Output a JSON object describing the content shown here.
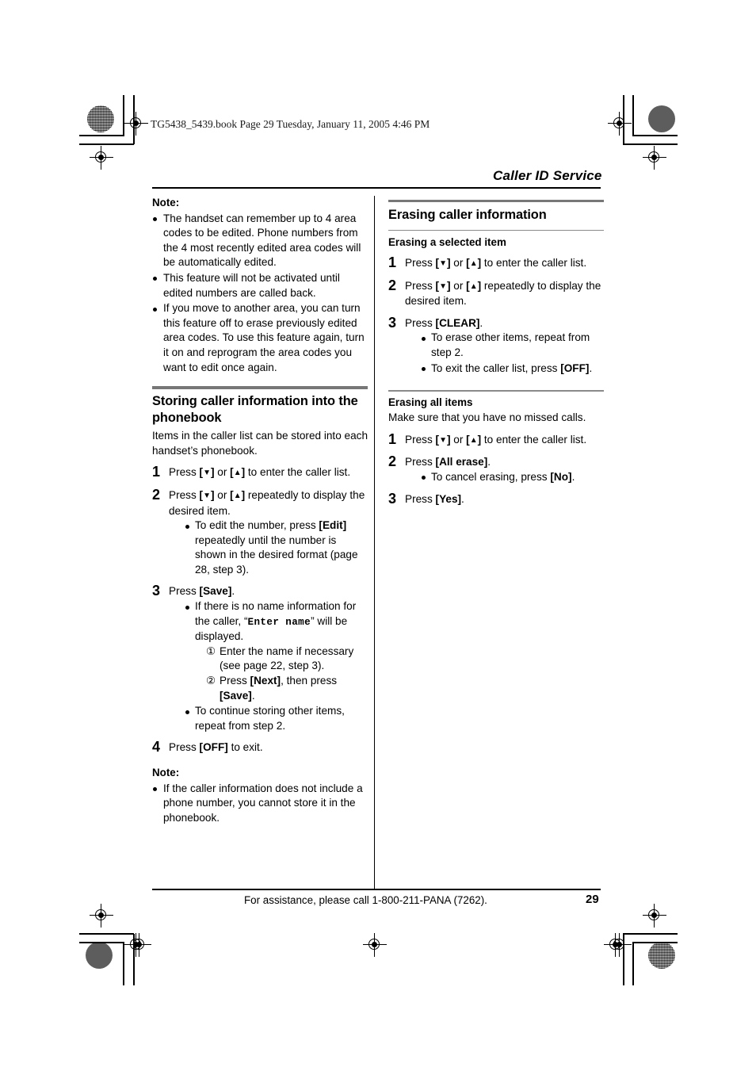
{
  "scan_header": "TG5438_5439.book  Page 29  Tuesday, January 11, 2005  4:46 PM",
  "running_head": "Caller ID Service",
  "left_column": {
    "note_top": {
      "label": "Note:",
      "bullets": [
        "The handset can remember up to 4 area codes to be edited. Phone numbers from the 4 most recently edited area codes will be automatically edited.",
        "This feature will not be activated until edited numbers are called back.",
        "If you move to another area, you can turn this feature off to erase previously edited area codes. To use this feature again, turn it on and reprogram the area codes you want to edit once again."
      ]
    },
    "section": {
      "heading": "Storing caller information into the phonebook",
      "intro": "Items in the caller list can be stored into each handset’s phonebook.",
      "step1": {
        "num": "1",
        "press": "Press",
        "key_down": "▼",
        "or": "or",
        "key_up": "▲",
        "tail": "to enter the caller list."
      },
      "step2": {
        "num": "2",
        "press": "Press",
        "key_down": "▼",
        "or": "or",
        "key_up": "▲",
        "tail": "repeatedly to display the desired item.",
        "bullet_lead": "To edit the number, press",
        "bullet_key": "Edit",
        "bullet_tail": "repeatedly until the number is shown in the desired format (page 28, step 3)."
      },
      "step3": {
        "num": "3",
        "press": "Press",
        "key": "Save",
        "period": ".",
        "bullet1_lead": "If there is no name information for the caller, “",
        "bullet1_lcd": "Enter name",
        "bullet1_tail": "” will be displayed.",
        "sub1_marker": "①",
        "sub1_text": "Enter the name if necessary (see page 22, step 3).",
        "sub2_marker": "②",
        "sub2_lead": "Press",
        "sub2_key1": "Next",
        "sub2_mid": ", then press",
        "sub2_key2": "Save",
        "sub2_end": ".",
        "bullet2": "To continue storing other items, repeat from step 2."
      },
      "step4": {
        "num": "4",
        "press": "Press",
        "key": "OFF",
        "tail": "to exit."
      }
    },
    "note_bottom": {
      "label": "Note:",
      "bullets": [
        "If the caller information does not include a phone number, you cannot store it in the phonebook."
      ]
    }
  },
  "right_column": {
    "heading": "Erasing caller information",
    "selected_item": {
      "subheading": "Erasing a selected item",
      "step1": {
        "num": "1",
        "press": "Press",
        "key_down": "▼",
        "or": "or",
        "key_up": "▲",
        "tail": "to enter the caller list."
      },
      "step2": {
        "num": "2",
        "press": "Press",
        "key_down": "▼",
        "or": "or",
        "key_up": "▲",
        "tail": "repeatedly to display the desired item."
      },
      "step3": {
        "num": "3",
        "press": "Press",
        "key": "CLEAR",
        "period": ".",
        "bullet1": "To erase other items, repeat from step 2.",
        "bullet2_lead": "To exit the caller list, press",
        "bullet2_key": "OFF",
        "bullet2_end": "."
      }
    },
    "all_items": {
      "subheading": "Erasing all items",
      "intro": "Make sure that you have no missed calls.",
      "step1": {
        "num": "1",
        "press": "Press",
        "key_down": "▼",
        "or": "or",
        "key_up": "▲",
        "tail": "to enter the caller list."
      },
      "step2": {
        "num": "2",
        "press": "Press",
        "key": "All erase",
        "period": ".",
        "bullet_lead": "To cancel erasing, press",
        "bullet_key": "No",
        "bullet_end": "."
      },
      "step3": {
        "num": "3",
        "press": "Press",
        "key": "Yes",
        "period": "."
      }
    }
  },
  "footer": {
    "assistance": "For assistance, please call 1-800-211-PANA (7262).",
    "page_number": "29"
  }
}
